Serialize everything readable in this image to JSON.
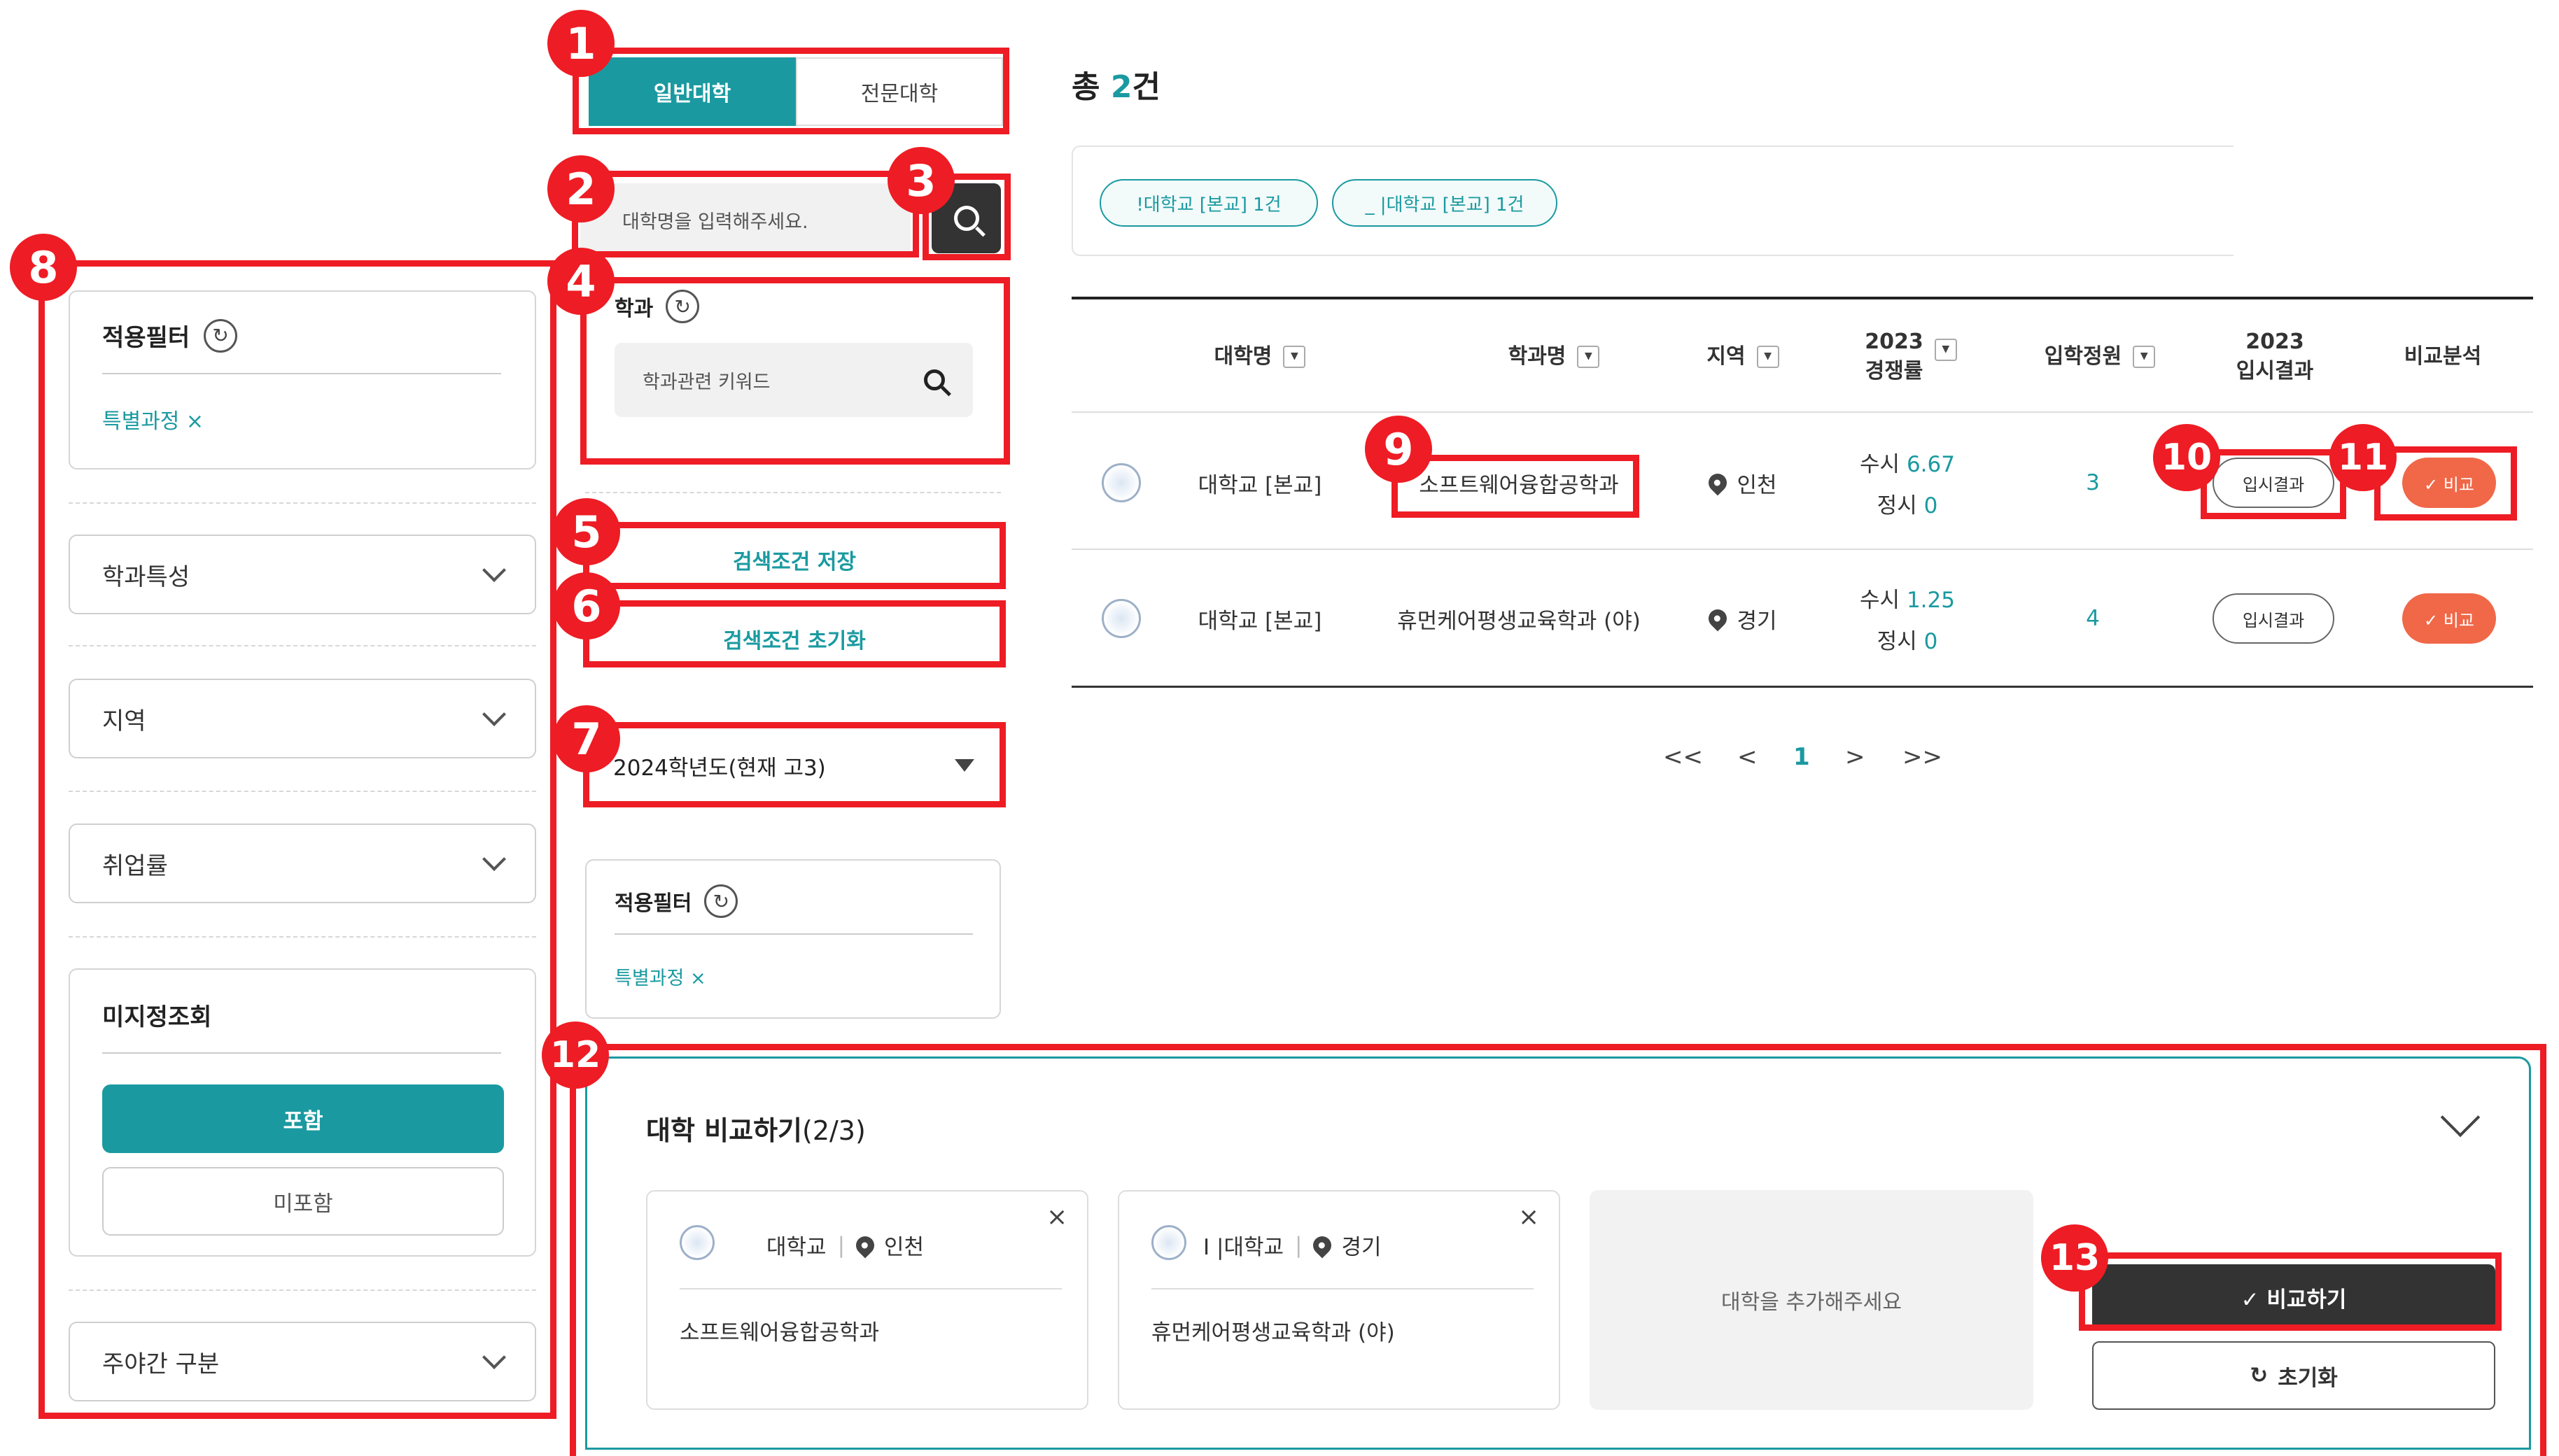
{
  "annotations": [
    "1",
    "2",
    "3",
    "4",
    "5",
    "6",
    "7",
    "8",
    "9",
    "10",
    "11",
    "12",
    "13"
  ],
  "colors": {
    "accent": "#1a9aa0",
    "annotation": "#ee1c24",
    "compare": "#f06848",
    "dark_button": "#333333"
  },
  "tabs": [
    {
      "label": "일반대학",
      "active": true
    },
    {
      "label": "전문대학",
      "active": false
    }
  ],
  "search": {
    "placeholder": "대학명을 입력해주세요.",
    "button_icon": "search-icon"
  },
  "department": {
    "title": "학과",
    "placeholder": "학과관련 키워드"
  },
  "buttons": {
    "save_search": "검색조건 저장",
    "reset_search": "검색조건 초기화"
  },
  "year_select": {
    "value": "2024학년도(현재 고3)"
  },
  "applied_filter_small": {
    "title": "적용필터",
    "chip": "특별과정 ×"
  },
  "left_panel": {
    "applied_filter": {
      "title": "적용필터",
      "chip": "특별과정 ×"
    },
    "dropdowns": [
      "학과특성",
      "지역",
      "취업률"
    ],
    "unspecified": {
      "title": "미지정조회",
      "include": "포함",
      "exclude": "미포함"
    },
    "day_night": "주야간 구분"
  },
  "results": {
    "total_prefix": "총 ",
    "total_count": "2",
    "total_suffix": "건",
    "chips": [
      {
        "label": "!대학교 [본교] 1건"
      },
      {
        "label": "_ |대학교 [본교] 1건"
      }
    ]
  },
  "table": {
    "headers": {
      "univ": "대학명",
      "dept": "학과명",
      "region": "지역",
      "comp_year": "2023",
      "comp": "경쟁률",
      "quota": "입학정원",
      "result_year": "2023",
      "result": "입시결과",
      "compare": "비교분석"
    },
    "rows": [
      {
        "univ": "대학교 [본교]",
        "dept": "소프트웨어융합공학과",
        "region": "인천",
        "susi_label": "수시",
        "susi": "6.67",
        "jeongsi_label": "정시",
        "jeongsi": "0",
        "quota": "3",
        "result_btn": "입시결과",
        "compare_btn": "✓ 비교"
      },
      {
        "univ": "대학교 [본교]",
        "dept": "휴먼케어평생교육학과 (야)",
        "region": "경기",
        "susi_label": "수시",
        "susi": "1.25",
        "jeongsi_label": "정시",
        "jeongsi": "0",
        "quota": "4",
        "result_btn": "입시결과",
        "compare_btn": "✓ 비교"
      }
    ]
  },
  "pagination": {
    "first": "<<",
    "prev": "<",
    "current": "1",
    "next": ">",
    "last": ">>"
  },
  "compare_panel": {
    "title": "대학 비교하기",
    "count": "(2/3)",
    "cards": [
      {
        "univ": "대학교",
        "region": "인천",
        "dept": "소프트웨어융합공학과"
      },
      {
        "univ": "I   |대학교",
        "region": "경기",
        "dept": "휴먼케어평생교육학과 (야)"
      }
    ],
    "empty_slot": "대학을 추가해주세요",
    "compare_button": "✓ 비교하기",
    "reset_button": "초기화",
    "reset_icon": "↻"
  }
}
